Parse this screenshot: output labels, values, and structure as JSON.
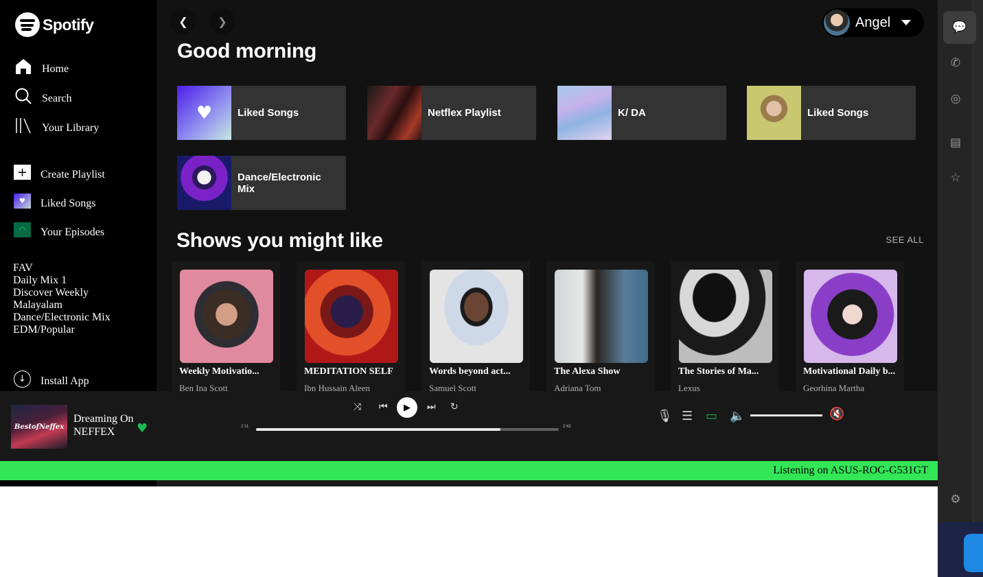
{
  "brand": {
    "name": "Spotify"
  },
  "sidebar": {
    "nav": [
      {
        "label": "Home",
        "icon": "home-icon"
      },
      {
        "label": "Search",
        "icon": "search-icon"
      },
      {
        "label": "Your Library",
        "icon": "library-icon"
      }
    ],
    "actions": [
      {
        "label": "Create Playlist",
        "icon": "plus-icon"
      },
      {
        "label": "Liked Songs",
        "icon": "heart-icon"
      },
      {
        "label": "Your Episodes",
        "icon": "podcast-icon"
      }
    ],
    "playlists": [
      "FAV",
      "Daily Mix 1",
      "Discover Weekly",
      "Malayalam",
      "Dance/Electronic Mix",
      "EDM/Popular"
    ],
    "install_label": "Install App"
  },
  "header": {
    "user_name": "Angel"
  },
  "greeting": "Good morning",
  "quick_picks": [
    {
      "label": "Liked Songs"
    },
    {
      "label": "Netflex Playlist"
    },
    {
      "label": "K/ DA"
    },
    {
      "label": "Liked Songs"
    },
    {
      "label": "Dance/Electronic Mix"
    }
  ],
  "shows_section": {
    "title": "Shows you might like",
    "see_all": "SEE ALL",
    "items": [
      {
        "title": "Weekly Motivatio...",
        "author": "Ben Ina Scott"
      },
      {
        "title": "MEDITATION SELF",
        "author": "Ibn Hussain Aleen"
      },
      {
        "title": "Words beyond act...",
        "author": "Samuel Scott"
      },
      {
        "title": "The Alexa Show",
        "author": "Adriana Tom"
      },
      {
        "title": "The Stories of Ma...",
        "author": "Lexus"
      },
      {
        "title": "Motivational Daily b...",
        "author": "Georhina Martha"
      }
    ]
  },
  "player": {
    "track_title": "Dreaming On",
    "artist": "NEFFEX",
    "elapsed": "2:11",
    "duration": "2:42",
    "progress": 0.808,
    "volume": 1.0
  },
  "status_bar": {
    "text": "Listening on ASUS-ROG-G531GT"
  },
  "colors": {
    "accent": "#1db954",
    "status_bar": "#32e657",
    "background": "#121212"
  }
}
